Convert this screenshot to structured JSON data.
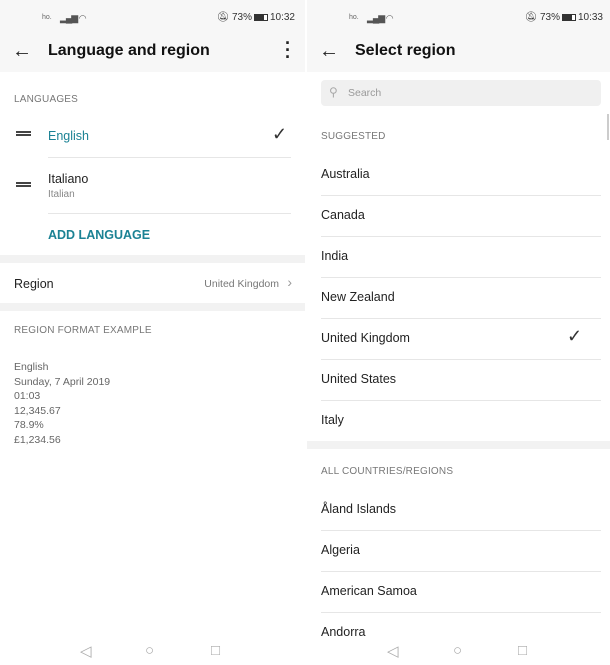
{
  "left": {
    "status": {
      "carrier": "ho.",
      "battery": "73%",
      "time": "10:32"
    },
    "title": "Language and region",
    "languages_header": "LANGUAGES",
    "languages": [
      {
        "name": "English",
        "selected": true
      },
      {
        "name": "Italiano",
        "sub": "Italian"
      }
    ],
    "add_language": "ADD LANGUAGE",
    "region_label": "Region",
    "region_value": "United Kingdom",
    "format_header": "REGION FORMAT EXAMPLE",
    "format_example": [
      "English",
      "Sunday, 7 April 2019",
      "01:03",
      "12,345.67",
      "78.9%",
      "£1,234.56"
    ]
  },
  "right": {
    "status": {
      "carrier": "ho.",
      "battery": "73%",
      "time": "10:33"
    },
    "title": "Select region",
    "search_placeholder": "Search",
    "suggested_header": "SUGGESTED",
    "suggested": [
      "Australia",
      "Canada",
      "India",
      "New Zealand",
      "United Kingdom",
      "United States",
      "Italy"
    ],
    "selected": "United Kingdom",
    "all_header": "ALL COUNTRIES/REGIONS",
    "all": [
      "Åland Islands",
      "Algeria",
      "American Samoa",
      "Andorra"
    ]
  },
  "colors": {
    "accent": "#1b8294"
  }
}
